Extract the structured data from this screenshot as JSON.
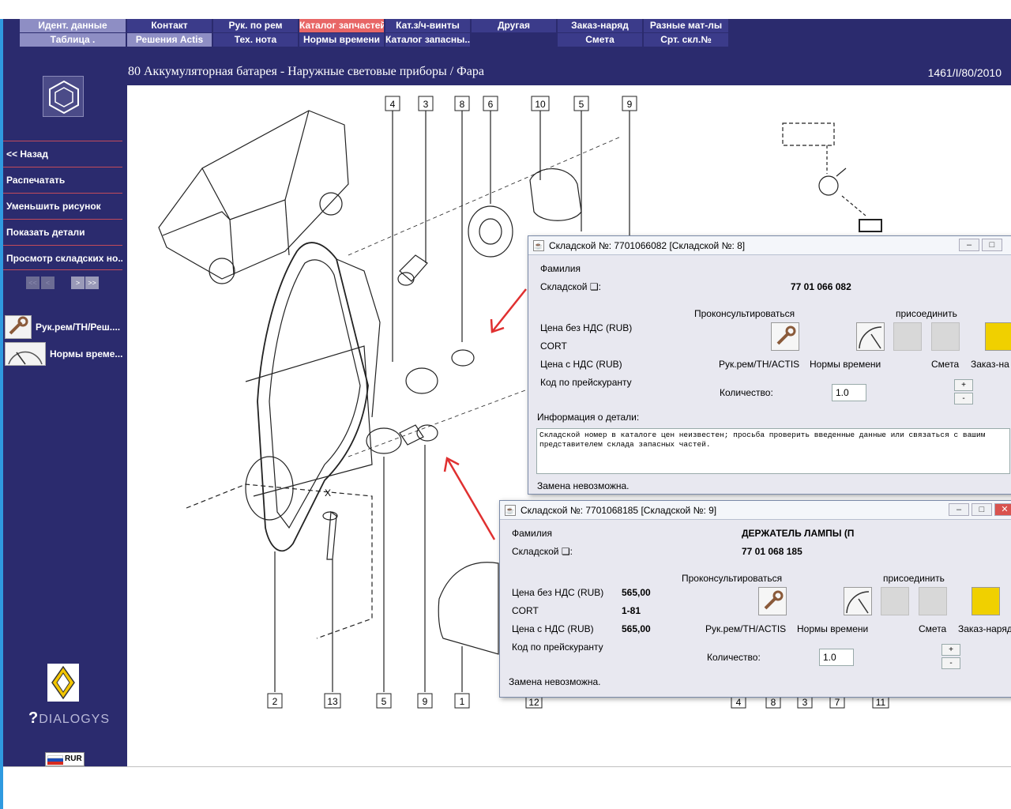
{
  "menu": {
    "row1": [
      "Идент. данные",
      "Контакт",
      "Рук. по рем",
      "Каталог запчастей",
      "Кат.з/ч-винты",
      "Другая",
      "Заказ-наряд",
      "Разные мат-лы"
    ],
    "row2": [
      "Таблица .",
      "Решения Actis",
      "Тех. нота",
      "Нормы времени",
      "Каталог запасны...",
      "Смета",
      "Срт. скл.№"
    ]
  },
  "page": {
    "title": "80 Аккумуляторная батарея - Наружные световые приборы / Фара",
    "doc_ref": "1461/I/80/2010"
  },
  "sidebar": {
    "items": [
      "<< Назад",
      "Распечатать",
      "Уменьшить рисунок",
      "Показать детали",
      "Просмотр складских но..."
    ],
    "pager": [
      "<<",
      "<",
      ">",
      ">>"
    ],
    "shortcuts": [
      "Рук.рем/ТН/Реш....",
      "Нормы време..."
    ],
    "brand": "DIALOGYS",
    "currency": "RUR"
  },
  "diagram": {
    "top_callouts": [
      "4",
      "3",
      "8",
      "6",
      "10",
      "5",
      "9"
    ],
    "bottom_callouts": [
      "2",
      "13",
      "5",
      "9",
      "1",
      "12",
      "4",
      "8",
      "3",
      "7",
      "11"
    ],
    "axis_label": "X"
  },
  "dialog1": {
    "title": "Складской №: 7701066082 [Складской №: 8]",
    "familia_label": "Фамилия",
    "sklad_label": "Складской ❏:",
    "sklad_value": "77 01 066 082",
    "consult_label": "Проконсультироваться",
    "attach_label": "присоединить",
    "price_nonds_label": "Цена без НДС (RUB)",
    "cort_label": "CORT",
    "price_nds_label": "Цена с НДС (RUB)",
    "pricelist_label": "Код по прейскуранту",
    "action_labels": [
      "Рук.рем/TH/ACTIS",
      "Нормы времени",
      "Смета",
      "Заказ-на"
    ],
    "qty_label": "Количество:",
    "qty_value": "1.0",
    "info_label": "Информация о детали:",
    "info_text": "Складской номер в каталоге цен неизвестен; просьба проверить введенные данные или связаться с вашим представителем склада запасных частей.",
    "status": "Замена невозможна."
  },
  "dialog2": {
    "title": "Складской №: 7701068185 [Складской №: 9]",
    "familia_label": "Фамилия",
    "familia_value": "ДЕРЖАТЕЛЬ ЛАМПЫ (П",
    "sklad_label": "Складской ❏:",
    "sklad_value": "77 01 068 185",
    "consult_label": "Проконсультироваться",
    "attach_label": "присоединить",
    "price_nonds_label": "Цена без НДС (RUB)",
    "price_nonds_value": "565,00",
    "cort_label": "CORT",
    "cort_value": "1-81",
    "price_nds_label": "Цена с НДС (RUB)",
    "price_nds_value": "565,00",
    "pricelist_label": "Код по прейскуранту",
    "action_labels": [
      "Рук.рем/TH/ACTIS",
      "Нормы времени",
      "Смета",
      "Заказ-наряд"
    ],
    "qty_label": "Количество:",
    "qty_value": "1.0",
    "status": "Замена невозможна."
  },
  "colors": {
    "background": "#2b2b6e",
    "menu_active": "#e86666",
    "sidebar_divider": "#c24b5a",
    "arrow": "#e03030"
  }
}
